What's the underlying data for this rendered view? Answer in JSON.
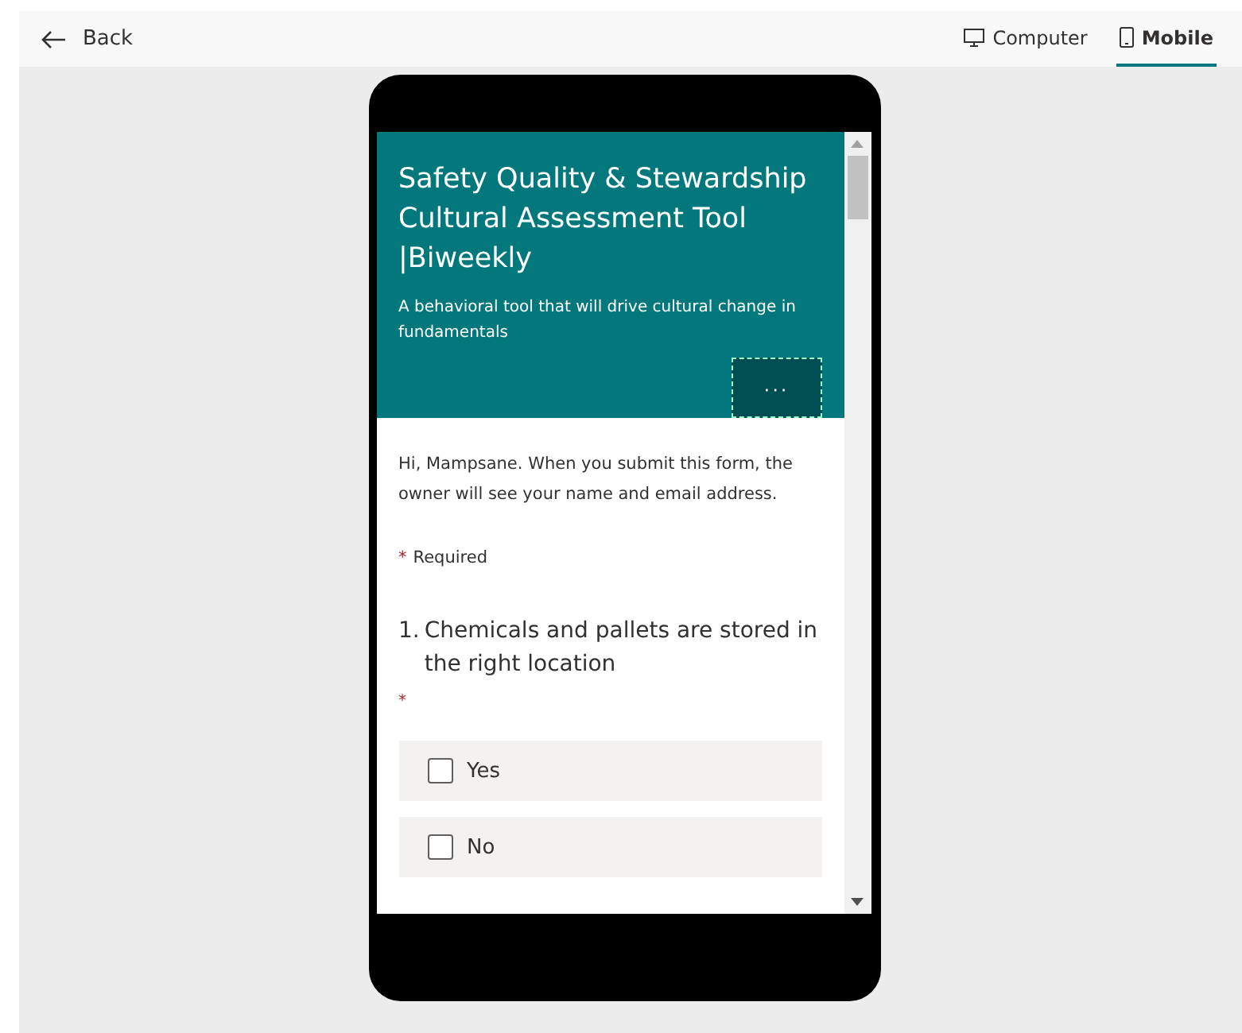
{
  "top_bar": {
    "back": "Back",
    "views": [
      {
        "label": "Computer",
        "kind": "computer",
        "selected": false
      },
      {
        "label": "Mobile",
        "kind": "mobile",
        "selected": true
      }
    ]
  },
  "form": {
    "title": "Safety Quality & Stewardship Cultural Assessment Tool |Biweekly",
    "description": "A behavioral tool that will drive cultural change in fundamentals",
    "more_button": "···",
    "notice": "Hi, Mampsane. When you submit this form, the owner will see your name and email address.",
    "required_mark": "*",
    "required_label": "Required",
    "questions": [
      {
        "number": "1.",
        "text": "Chemicals and pallets are stored in the right location",
        "required_mark": "*",
        "options": [
          {
            "label": "Yes",
            "checked": false
          },
          {
            "label": "No",
            "checked": false
          }
        ]
      }
    ]
  }
}
